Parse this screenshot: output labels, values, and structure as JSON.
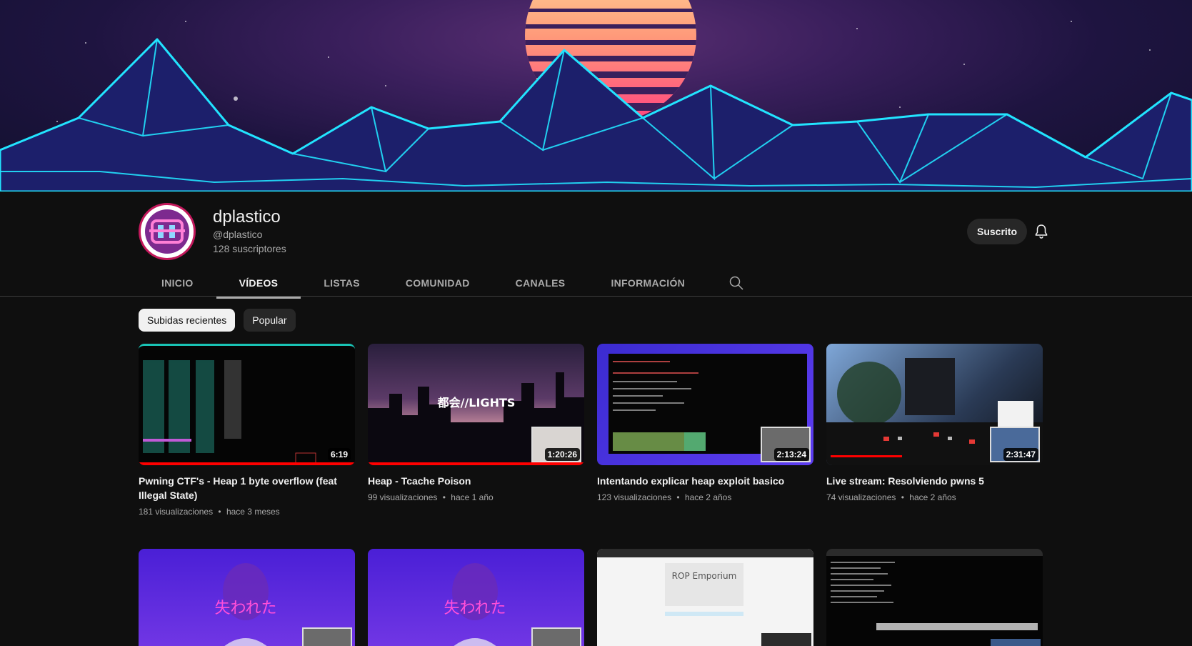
{
  "channel": {
    "name": "dplastico",
    "handle": "@dplastico",
    "subscribers": "128 suscriptores",
    "subscribe_label": "Suscrito"
  },
  "tabs": [
    "INICIO",
    "VÍDEOS",
    "LISTAS",
    "COMUNIDAD",
    "CANALES",
    "INFORMACIÓN"
  ],
  "active_tab": "VÍDEOS",
  "chips": [
    "Subidas recientes",
    "Popular"
  ],
  "active_chip": "Subidas recientes",
  "videos": [
    {
      "title": "Pwning CTF's - Heap 1 byte overflow (feat Illegal State)",
      "duration": "6:19",
      "views": "181 visualizaciones",
      "age": "hace 3 meses",
      "thumb_text": "",
      "progress": 1.0
    },
    {
      "title": "Heap - Tcache Poison",
      "duration": "1:20:26",
      "views": "99 visualizaciones",
      "age": "hace 1 año",
      "thumb_text": "都会//LIGHTS",
      "progress": 1.0
    },
    {
      "title": "Intentando explicar heap exploit basico",
      "duration": "2:13:24",
      "views": "123 visualizaciones",
      "age": "hace 2 años",
      "thumb_text": "",
      "progress": 0.0
    },
    {
      "title": "Live stream: Resolviendo pwns 5",
      "duration": "2:31:47",
      "views": "74 visualizaciones",
      "age": "hace 2 años",
      "thumb_text": "",
      "progress": 0.0
    },
    {
      "title": "",
      "duration": "",
      "views": "",
      "age": "",
      "thumb_text": "失われた",
      "progress": 0.0
    },
    {
      "title": "",
      "duration": "",
      "views": "",
      "age": "",
      "thumb_text": "失われた",
      "progress": 0.0
    },
    {
      "title": "",
      "duration": "",
      "views": "",
      "age": "",
      "thumb_text": "ROP Emporium",
      "progress": 0.0
    },
    {
      "title": "",
      "duration": "",
      "views": "",
      "age": "",
      "thumb_text": "",
      "progress": 0.0
    }
  ],
  "meta_separator": "•",
  "icons": {
    "bell": "bell-icon",
    "search": "search-icon"
  }
}
